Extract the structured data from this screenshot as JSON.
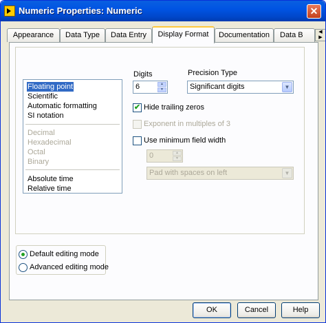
{
  "window": {
    "title": "Numeric Properties: Numeric",
    "close_glyph": "✕"
  },
  "tabs": [
    {
      "label": "Appearance"
    },
    {
      "label": "Data Type"
    },
    {
      "label": "Data Entry"
    },
    {
      "label": "Display Format",
      "active": true
    },
    {
      "label": "Documentation"
    },
    {
      "label": "Data B"
    }
  ],
  "format_list": {
    "group1": [
      "Floating point",
      "Scientific",
      "Automatic formatting",
      "SI notation"
    ],
    "group2": [
      "Decimal",
      "Hexadecimal",
      "Octal",
      "Binary"
    ],
    "group3": [
      "Absolute time",
      "Relative time"
    ],
    "selected": "Floating point"
  },
  "digits": {
    "label": "Digits",
    "value": "6"
  },
  "precision": {
    "label": "Precision Type",
    "value": "Significant digits"
  },
  "options": {
    "hide_trailing_zeros": {
      "label": "Hide trailing zeros",
      "checked": true
    },
    "exponent_multiples": {
      "label": "Exponent in multiples of 3",
      "checked": false,
      "disabled": true
    },
    "min_field_width": {
      "label": "Use minimum field width",
      "checked": false
    }
  },
  "min_width": {
    "value": "0"
  },
  "pad": {
    "value": "Pad with spaces on left"
  },
  "editing_mode": {
    "default_label": "Default editing mode",
    "advanced_label": "Advanced editing mode",
    "selected": "default"
  },
  "buttons": {
    "ok": "OK",
    "cancel": "Cancel",
    "help": "Help"
  },
  "icons": {
    "check": "✔",
    "spin_up": "▲",
    "spin_down": "▼",
    "dropdown": "▼",
    "scroll_left": "◀",
    "scroll_right": "▶"
  }
}
